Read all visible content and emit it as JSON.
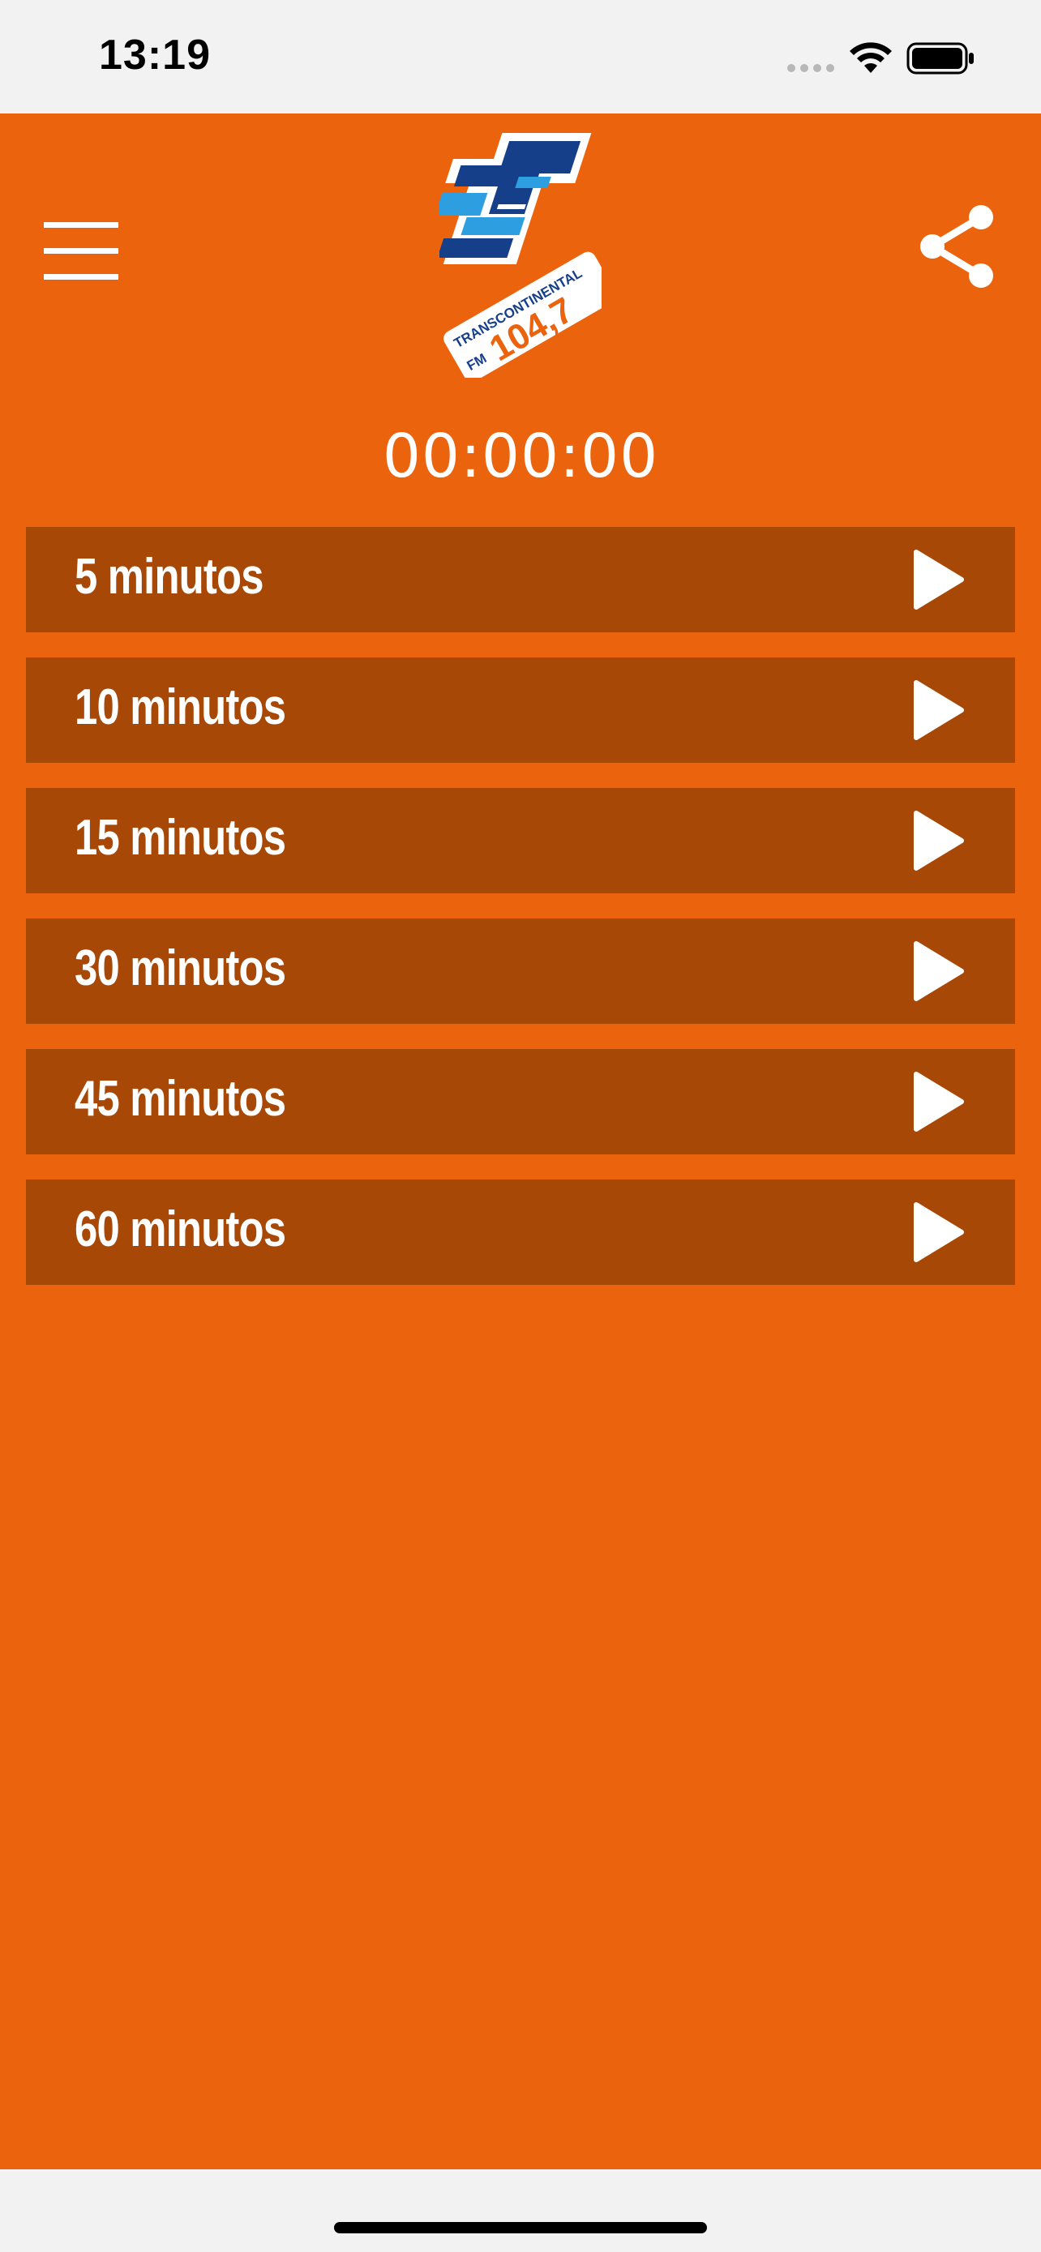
{
  "status_bar": {
    "time": "13:19"
  },
  "header": {
    "menu_icon": "hamburger-menu-icon",
    "share_icon": "share-icon",
    "logo": {
      "text_top": "TRANSCONTINENTAL",
      "text_fm": "FM",
      "frequency": "104,7"
    }
  },
  "timer": {
    "display": "00:00:00"
  },
  "sleep_options": [
    {
      "label": "5 minutos"
    },
    {
      "label": "10 minutos"
    },
    {
      "label": "15 minutos"
    },
    {
      "label": "30 minutos"
    },
    {
      "label": "45 minutos"
    },
    {
      "label": "60 minutos"
    }
  ],
  "colors": {
    "background": "#ec630d",
    "row": "#a74806",
    "logo_dark_blue": "#163f8a",
    "logo_light_blue": "#2d9fe0",
    "logo_orange": "#ec630d"
  }
}
